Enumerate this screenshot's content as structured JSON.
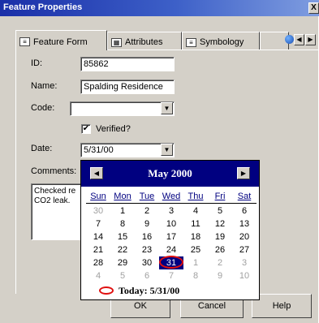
{
  "window": {
    "title": "Feature Properties",
    "close_glyph": "X"
  },
  "tabs": [
    {
      "label": "Feature Form",
      "icon": "form-icon",
      "active": true
    },
    {
      "label": "Attributes",
      "icon": "table-icon",
      "active": false
    },
    {
      "label": "Symbology",
      "icon": "symbology-icon",
      "active": false
    }
  ],
  "form": {
    "id_label": "ID:",
    "id_value": "85862",
    "name_label": "Name:",
    "name_value": "Spalding Residence",
    "code_label": "Code:",
    "code_value": "",
    "verified_label": "Verified?",
    "verified_checked": true,
    "date_label": "Date:",
    "date_value": "5/31/00",
    "comments_label": "Comments:",
    "comments_value": "Checked re\nCO2 leak."
  },
  "calendar": {
    "title": "May 2000",
    "days_of_week": [
      "Sun",
      "Mon",
      "Tue",
      "Wed",
      "Thu",
      "Fri",
      "Sat"
    ],
    "weeks": [
      [
        {
          "d": "30",
          "o": true
        },
        {
          "d": "1"
        },
        {
          "d": "2"
        },
        {
          "d": "3"
        },
        {
          "d": "4"
        },
        {
          "d": "5"
        },
        {
          "d": "6"
        }
      ],
      [
        {
          "d": "7"
        },
        {
          "d": "8"
        },
        {
          "d": "9"
        },
        {
          "d": "10"
        },
        {
          "d": "11"
        },
        {
          "d": "12"
        },
        {
          "d": "13"
        }
      ],
      [
        {
          "d": "14"
        },
        {
          "d": "15"
        },
        {
          "d": "16"
        },
        {
          "d": "17"
        },
        {
          "d": "18"
        },
        {
          "d": "19"
        },
        {
          "d": "20"
        }
      ],
      [
        {
          "d": "21"
        },
        {
          "d": "22"
        },
        {
          "d": "23"
        },
        {
          "d": "24"
        },
        {
          "d": "25"
        },
        {
          "d": "26"
        },
        {
          "d": "27"
        }
      ],
      [
        {
          "d": "28"
        },
        {
          "d": "29"
        },
        {
          "d": "30"
        },
        {
          "d": "31",
          "s": true
        },
        {
          "d": "1",
          "o": true
        },
        {
          "d": "2",
          "o": true
        },
        {
          "d": "3",
          "o": true
        }
      ],
      [
        {
          "d": "4",
          "o": true
        },
        {
          "d": "5",
          "o": true
        },
        {
          "d": "6",
          "o": true
        },
        {
          "d": "7",
          "o": true
        },
        {
          "d": "8",
          "o": true
        },
        {
          "d": "9",
          "o": true
        },
        {
          "d": "10",
          "o": true
        }
      ]
    ],
    "today_label": "Today: 5/31/00",
    "colors": {
      "header": "#000080",
      "today_ring": "#e01010"
    }
  },
  "buttons": {
    "ok": "OK",
    "cancel": "Cancel",
    "help": "Help"
  }
}
